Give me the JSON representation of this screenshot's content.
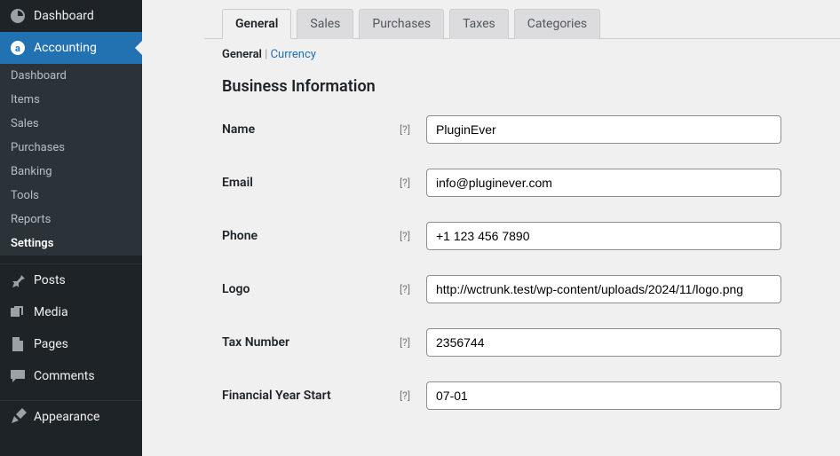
{
  "sidebar": {
    "dashboard": "Dashboard",
    "accounting": "Accounting",
    "submenu": [
      "Dashboard",
      "Items",
      "Sales",
      "Purchases",
      "Banking",
      "Tools",
      "Reports",
      "Settings"
    ],
    "submenu_active_index": 7,
    "posts": "Posts",
    "media": "Media",
    "pages": "Pages",
    "comments": "Comments",
    "appearance": "Appearance"
  },
  "tabs": {
    "items": [
      "General",
      "Sales",
      "Purchases",
      "Taxes",
      "Categories"
    ],
    "active_index": 0
  },
  "subnav": {
    "general": "General",
    "currency": "Currency"
  },
  "section_title": "Business Information",
  "help_token": "[?]",
  "fields": {
    "name": {
      "label": "Name",
      "value": "PluginEver"
    },
    "email": {
      "label": "Email",
      "value": "info@pluginever.com"
    },
    "phone": {
      "label": "Phone",
      "value": "+1 123 456 7890"
    },
    "logo": {
      "label": "Logo",
      "value": "http://wctrunk.test/wp-content/uploads/2024/11/logo.png"
    },
    "tax_number": {
      "label": "Tax Number",
      "value": "2356744"
    },
    "financial_year_start": {
      "label": "Financial Year Start",
      "value": "07-01"
    }
  }
}
